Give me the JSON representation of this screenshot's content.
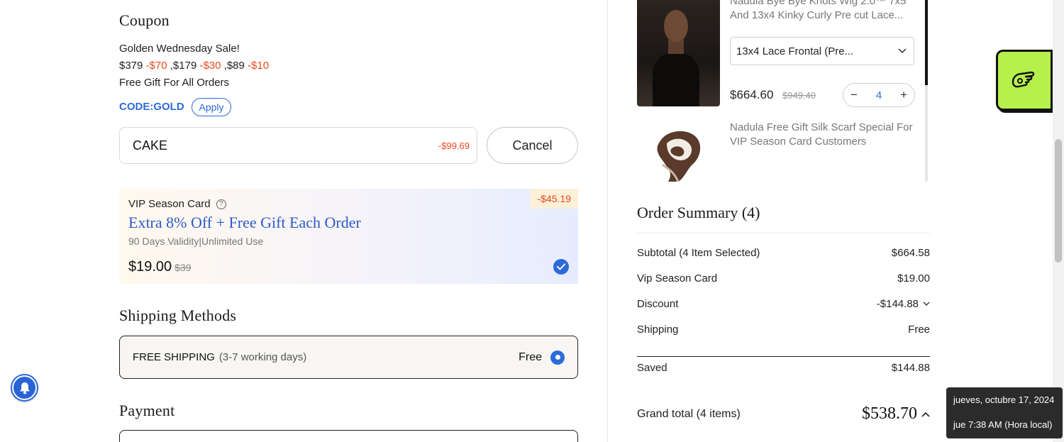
{
  "coupon": {
    "title": "Coupon",
    "promo_title": "Golden Wednesday Sale!",
    "tiers": [
      {
        "threshold": "$379",
        "discount": "-$70",
        "sep": ","
      },
      {
        "threshold": "$179",
        "discount": "-$30",
        "sep": ","
      },
      {
        "threshold": "$89",
        "discount": "-$10",
        "sep": ""
      }
    ],
    "gift_line": "Free Gift For All Orders",
    "code_label": "CODE:GOLD",
    "apply_label": "Apply",
    "input_value": "CAKE",
    "input_discount": "-$99.69",
    "cancel_label": "Cancel"
  },
  "vip": {
    "badge": "-$45.19",
    "name": "VIP Season Card",
    "help_glyph": "?",
    "headline": "Extra 8% Off + Free Gift Each Order",
    "subtitle": "90 Days Validity|Unlimited Use",
    "price": "$19.00",
    "old_price": "$39",
    "selected": true
  },
  "shipping": {
    "title": "Shipping Methods",
    "method_name": "FREE SHIPPING",
    "method_days": "(3-7 working days)",
    "method_price": "Free"
  },
  "payment": {
    "title": "Payment"
  },
  "cart": {
    "product_title": "Nadula Bye Bye Knots Wig 2.0™ 7x5 And 13x4 Kinky Curly Pre cut Lace...",
    "variant": "13x4 Lace Frontal (Pre...",
    "price": "$664.60",
    "old_price": "$949.40",
    "qty": "4",
    "qty_minus": "−",
    "qty_plus": "+",
    "gift_title": "Nadula Free Gift Silk Scarf Special For VIP Season Card Customers"
  },
  "summary": {
    "title": "Order Summary (4)",
    "rows": [
      {
        "label": "Subtotal (4 Item Selected)",
        "value": "$664.58"
      },
      {
        "label": "Vip Season Card",
        "value": "$19.00"
      },
      {
        "label": "Discount",
        "value": "-$144.88"
      },
      {
        "label": "Shipping",
        "value": "Free"
      }
    ],
    "saved_label": "Saved",
    "saved_value": "$144.88",
    "grand_label": "Grand total (4 items)",
    "grand_value": "$538.70"
  },
  "tooltip": {
    "date": "jueves, octubre 17, 2024",
    "time": "jue 7:38 AM (Hora local)"
  },
  "colors": {
    "accent": "#2e6ad9",
    "discount_red": "#e8491d",
    "fab_green": "#b6f04a"
  }
}
